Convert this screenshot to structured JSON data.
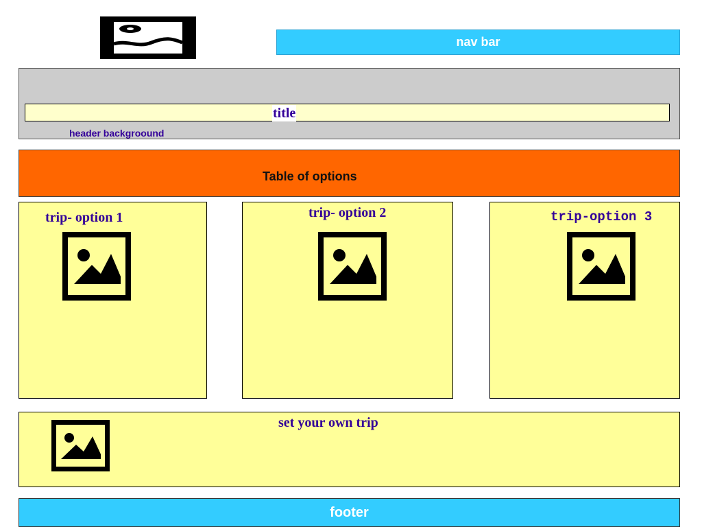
{
  "colors": {
    "nav_bg": "#33ccff",
    "header_bg": "#cccccc",
    "title_bg": "#ffffcc",
    "options_bg": "#ff6600",
    "card_bg": "#ffff99",
    "footer_bg": "#33ccff",
    "label_text": "#330099",
    "dark_text": "#111111"
  },
  "logo": {
    "icon": "logo-image-icon"
  },
  "nav": {
    "label": "nav bar"
  },
  "header": {
    "title": "title",
    "background_label": "header backgroound"
  },
  "options": {
    "label": "Table of options"
  },
  "trips": [
    {
      "label": "trip- option 1",
      "icon": "image-placeholder-icon"
    },
    {
      "label": "trip- option 2",
      "icon": "image-placeholder-icon"
    },
    {
      "label": "trip-option 3",
      "icon": "image-placeholder-icon"
    }
  ],
  "custom_trip": {
    "label": "set your own trip",
    "icon": "image-placeholder-icon"
  },
  "footer": {
    "label": "footer"
  }
}
